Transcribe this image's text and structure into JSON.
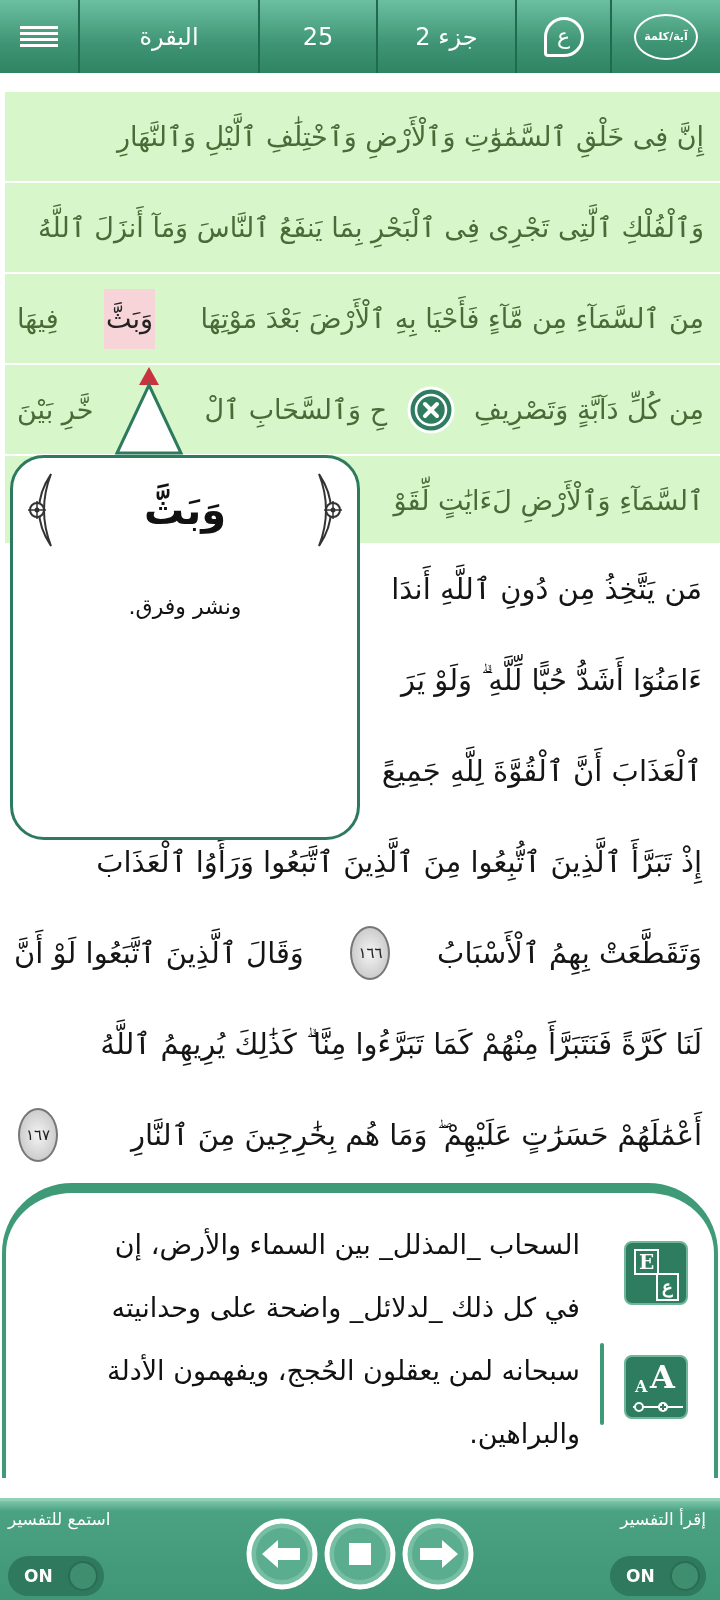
{
  "top_bar": {
    "menu_button": {
      "kind": "menu"
    },
    "surah": "البقرة",
    "page": "25",
    "juz": "جزء 2",
    "tafsir_button": "ع",
    "mode_button": "آية/كلمة"
  },
  "verse_lines": [
    {
      "segments": [
        {
          "kind": "text",
          "text": "إِنَّ فِى خَلْقِ ٱلسَّمَٰوَٰتِ وَٱلْأَرْضِ وَٱخْتِلَٰفِ ٱلَّيْلِ وَٱلنَّهَارِ",
          "selected": false
        }
      ]
    },
    {
      "segments": [
        {
          "kind": "text",
          "text": "وَٱلْفُلْكِ ٱلَّتِى تَجْرِى فِى ٱلْبَحْرِ بِمَا يَنفَعُ ٱلنَّاسَ وَمَآ أَنزَلَ ٱللَّهُ",
          "selected": false
        }
      ]
    },
    {
      "segments": [
        {
          "kind": "text",
          "text": "مِنَ ٱلسَّمَآءِ مِن مَّآءٍ فَأَحْيَا بِهِ ٱلْأَرْضَ بَعْدَ مَوْتِهَا",
          "selected": false
        },
        {
          "kind": "text",
          "text": "وَبَثَّ",
          "selected": true
        },
        {
          "kind": "text",
          "text": "فِيهَا",
          "selected": false
        }
      ]
    },
    {
      "segments": [
        {
          "kind": "text",
          "text": "مِن كُلِّ دَآبَّةٍ وَتَصْرِيفِ",
          "selected": false
        },
        {
          "kind": "close"
        },
        {
          "kind": "text",
          "text": "حِ وَٱلسَّحَابِ ٱلْ",
          "selected": false
        },
        {
          "kind": "pointer"
        },
        {
          "kind": "text",
          "text": "خَّرِ بَيْنَ",
          "selected": false
        }
      ]
    },
    {
      "segments": [
        {
          "kind": "text",
          "text": "ٱلسَّمَآءِ وَٱلْأَرْضِ لَءَايَٰتٍ لِّقَوْ",
          "selected": false
        }
      ]
    }
  ],
  "popup": {
    "word": "وَبَثَّ",
    "meaning": "ونشر وفرق."
  },
  "page_lines": [
    {
      "segments": [
        {
          "kind": "text",
          "text": "مَن يَتَّخِذُ مِن دُونِ ٱللَّهِ أَندَا"
        }
      ]
    },
    {
      "segments": [
        {
          "kind": "text",
          "text": "ءَامَنُوٓا أَشَدُّ حُبًّا لِّلَّهِ ۗ وَلَوْ يَرَ"
        }
      ]
    },
    {
      "segments": [
        {
          "kind": "text",
          "text": "ٱلْعَذَابَ أَنَّ ٱلْقُوَّةَ لِلَّهِ جَمِيعً"
        }
      ]
    },
    {
      "segments": [
        {
          "kind": "text",
          "text": "إِذْ تَبَرَّأَ ٱلَّذِينَ ٱتُّبِعُوا مِنَ ٱلَّذِينَ ٱتَّبَعُوا وَرَأَوُا ٱلْعَذَابَ"
        }
      ]
    },
    {
      "segments": [
        {
          "kind": "text",
          "text": "وَتَقَطَّعَتْ بِهِمُ ٱلْأَسْبَابُ"
        },
        {
          "kind": "marker",
          "text": "١٦٦"
        },
        {
          "kind": "text",
          "text": "وَقَالَ ٱلَّذِينَ ٱتَّبَعُوا لَوْ أَنَّ"
        }
      ]
    },
    {
      "segments": [
        {
          "kind": "text",
          "text": "لَنَا كَرَّةً فَنَتَبَرَّأَ مِنْهُمْ كَمَا تَبَرَّءُوا مِنَّا ۗ كَذَٰلِكَ يُرِيهِمُ ٱللَّهُ"
        }
      ]
    },
    {
      "segments": [
        {
          "kind": "text",
          "text": "أَعْمَٰلَهُمْ حَسَرَٰتٍ عَلَيْهِمْ ۖ وَمَا هُم بِخَٰرِجِينَ مِنَ ٱلنَّارِ"
        },
        {
          "kind": "marker",
          "text": "١٦٧"
        }
      ]
    }
  ],
  "tafsir": {
    "text": "السحاب _المذلل_ بين السماء والأرض، إن في كل ذلك _لدلائل_ واضحة على وحدانيته سبحانه لمن يعقلون الحُجج، ويفهمون الأدلة والبراهين.",
    "translation_button": [
      "E",
      "ع"
    ],
    "font_size_button": [
      "A",
      "A"
    ]
  },
  "player": {
    "read_label": "إقرأ التفسير",
    "read_toggle": {
      "label": "ON",
      "on": true
    },
    "listen_label": "استمع للتفسير",
    "listen_toggle": {
      "label": "ON",
      "on": true
    },
    "buttons": [
      {
        "kind": "previous"
      },
      {
        "kind": "stop"
      },
      {
        "kind": "next"
      }
    ]
  }
}
